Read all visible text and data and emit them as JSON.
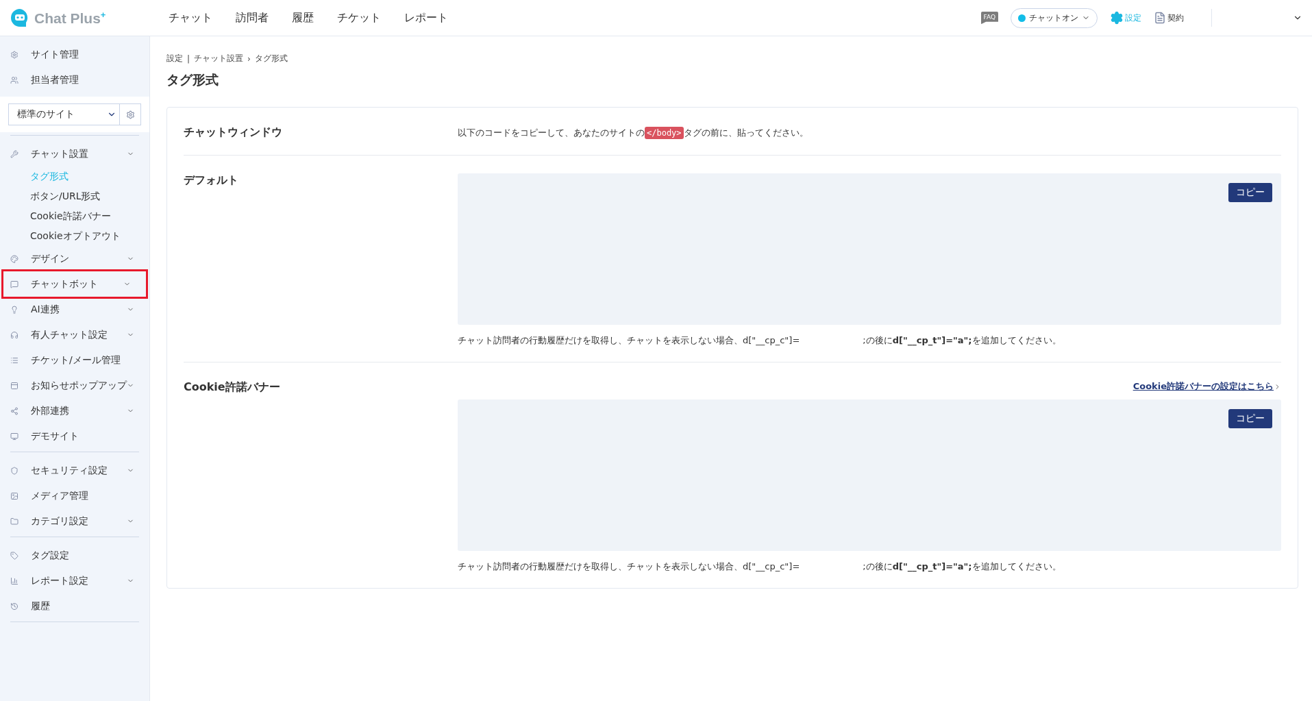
{
  "header": {
    "logo_text": "Chat Plus",
    "logo_sup": "+",
    "nav": [
      {
        "label": "チャット"
      },
      {
        "label": "訪問者"
      },
      {
        "label": "履歴"
      },
      {
        "label": "チケット"
      },
      {
        "label": "レポート"
      }
    ],
    "faq_label": "FAQ",
    "status": {
      "label": "チャットオン",
      "on": true
    },
    "settings_label": "設定",
    "contract_label": "契約"
  },
  "sidebar": {
    "top_items": [
      {
        "label": "サイト管理"
      },
      {
        "label": "担当者管理"
      }
    ],
    "site_select": {
      "value": "標準のサイト"
    },
    "groups": [
      [
        {
          "label": "チャット設置",
          "expandable": true,
          "highlighted": false,
          "children": [
            {
              "label": "タグ形式",
              "selected": true
            },
            {
              "label": "ボタン/URL形式",
              "selected": false
            },
            {
              "label": "Cookie許諾バナー",
              "selected": false
            },
            {
              "label": "Cookieオプトアウト",
              "selected": false
            }
          ]
        },
        {
          "label": "デザイン",
          "expandable": true,
          "highlighted": false
        },
        {
          "label": "チャットボット",
          "expandable": true,
          "highlighted": true
        },
        {
          "label": "AI連携",
          "expandable": true,
          "highlighted": false
        },
        {
          "label": "有人チャット設定",
          "expandable": true,
          "highlighted": false
        },
        {
          "label": "チケット/メール管理",
          "expandable": false,
          "highlighted": false
        },
        {
          "label": "お知らせポップアップ",
          "expandable": true,
          "highlighted": false
        },
        {
          "label": "外部連携",
          "expandable": true,
          "highlighted": false
        },
        {
          "label": "デモサイト",
          "expandable": false,
          "highlighted": false
        }
      ],
      [
        {
          "label": "セキュリティ設定",
          "expandable": true,
          "highlighted": false
        },
        {
          "label": "メディア管理",
          "expandable": false,
          "highlighted": false
        },
        {
          "label": "カテゴリ設定",
          "expandable": true,
          "highlighted": false
        }
      ],
      [
        {
          "label": "タグ設定",
          "expandable": false,
          "highlighted": false
        },
        {
          "label": "レポート設定",
          "expandable": true,
          "highlighted": false
        },
        {
          "label": "履歴",
          "expandable": false,
          "highlighted": false
        }
      ]
    ]
  },
  "breadcrumb": [
    {
      "label": "設定"
    },
    {
      "separator": "|",
      "label": "チャット設置"
    },
    {
      "separator": "›",
      "label": "タグ形式"
    }
  ],
  "page_title": "タグ形式",
  "card": {
    "intro": {
      "label": "チャットウィンドウ",
      "text_before": "以下のコードをコピーして、あなたのサイトの",
      "code": "</body>",
      "text_after": "タグの前に、貼ってください。"
    },
    "sections": [
      {
        "label": "デフォルト",
        "copy_label": "コピー",
        "note_before": "チャット訪問者の行動履歴だけを取得し、チャットを表示しない場合、d[\"__cp_c\"]=",
        "note_after": ";の後に**d[\"__cp_t\"]=\"a\";**を追加してください。"
      },
      {
        "label": "Cookie許諾バナー",
        "link": "Cookie許諾バナーの設定はこちら",
        "copy_label": "コピー",
        "note_before": "チャット訪問者の行動履歴だけを取得し、チャットを表示しない場合、d[\"__cp_c\"]=",
        "note_after": ";の後に**d[\"__cp_t\"]=\"a\";**を追加してください。"
      }
    ]
  }
}
